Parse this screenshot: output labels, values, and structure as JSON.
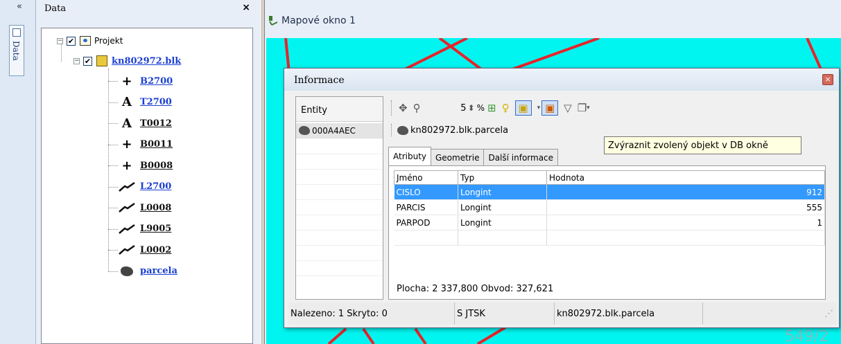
{
  "left_strip": {
    "collapse_glyph": "«",
    "data_tab_label": "Data",
    "tab_icon": "tree-structure-icon"
  },
  "data_panel": {
    "title": "Data",
    "close_glyph": "×",
    "tree": {
      "root": {
        "label": "Projekt",
        "checked": true,
        "icon": "project-icon"
      },
      "file": {
        "label": "kn802972.blk",
        "checked": true,
        "icon": "block-file-icon"
      },
      "layers": [
        {
          "symbol": "+",
          "label": "B2700",
          "kind": "point"
        },
        {
          "symbol": "A",
          "label": "T2700",
          "kind": "text"
        },
        {
          "symbol": "A",
          "label": "T0012",
          "kind": "text"
        },
        {
          "symbol": "+",
          "label": "B0011",
          "kind": "point"
        },
        {
          "symbol": "+",
          "label": "B0008",
          "kind": "point"
        },
        {
          "symbol": "line",
          "label": "L2700",
          "kind": "line"
        },
        {
          "symbol": "line",
          "label": "L0008",
          "kind": "line"
        },
        {
          "symbol": "line",
          "label": "L9005",
          "kind": "line"
        },
        {
          "symbol": "line",
          "label": "L0002",
          "kind": "line"
        },
        {
          "symbol": "polygon",
          "label": "parcela",
          "kind": "polygon"
        }
      ]
    }
  },
  "map_window": {
    "title": "Mapové okno 1",
    "map_labels": [
      "549/2"
    ]
  },
  "info_dialog": {
    "title": "Informace",
    "close_glyph": "×",
    "entity_header": "Entity",
    "entity_item": "000A4AEC",
    "toolbar": {
      "zoom_value": "5",
      "zoom_unit": "%",
      "spinner_glyph": "⬍"
    },
    "layer_path": "kn802972.blk.parcela",
    "tabs": [
      "Atributy",
      "Geometrie",
      "Další informace"
    ],
    "grid": {
      "columns": [
        "Jméno",
        "Typ",
        "Hodnota"
      ],
      "rows": [
        {
          "name": "CISLO",
          "type": "Longint",
          "value": "912",
          "selected": true
        },
        {
          "name": "PARCIS",
          "type": "Longint",
          "value": "555",
          "selected": false
        },
        {
          "name": "PARPOD",
          "type": "Longint",
          "value": "1",
          "selected": false
        }
      ]
    },
    "area_text": "Plocha: 2 337,800  Obvod: 327,621",
    "status": {
      "found": "Nalezeno: 1  Skryto: 0",
      "crs": "S JTSK",
      "layer": "kn802972.blk.parcela"
    }
  },
  "tooltip": "Zvýraznit zvolený objekt v DB okně",
  "colors": {
    "map_bg": "#00f5f0",
    "map_lines": "#e8232a",
    "selection": "#3399ff",
    "link": "#1b3fd0"
  }
}
